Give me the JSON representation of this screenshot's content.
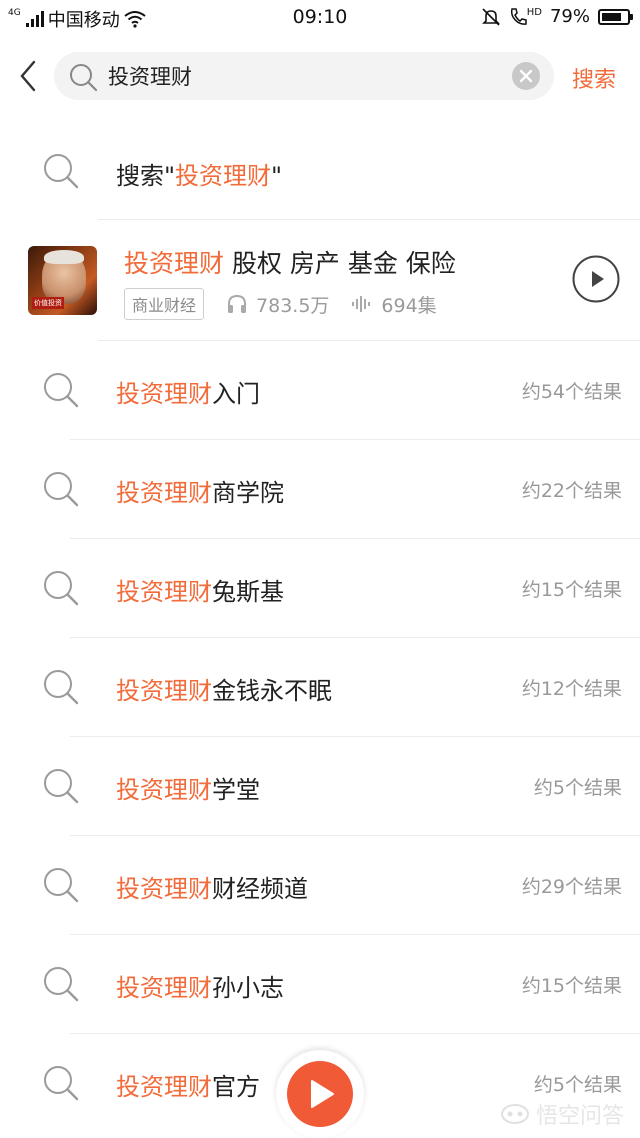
{
  "status_bar": {
    "network": "4G",
    "carrier": "中国移动",
    "time": "09:10",
    "hd": "HD",
    "battery": "79%",
    "battery_level": 0.79
  },
  "search": {
    "query": "投资理财",
    "button_label": "搜索"
  },
  "first_suggestion": {
    "prefix": "搜索\"",
    "keyword": "投资理财",
    "suffix": "\""
  },
  "album": {
    "cover_tag": "价值投资",
    "title_highlight": "投资理财",
    "title_rest": " 股权 房产 基金 保险",
    "category": "商业财经",
    "plays": "783.5万",
    "episodes": "694集"
  },
  "suggestions": [
    {
      "keyword": "投资理财",
      "rest": "入门",
      "count": "约54个结果"
    },
    {
      "keyword": "投资理财",
      "rest": "商学院",
      "count": "约22个结果"
    },
    {
      "keyword": "投资理财",
      "rest": "兔斯基",
      "count": "约15个结果"
    },
    {
      "keyword": "投资理财",
      "rest": "金钱永不眠",
      "count": "约12个结果"
    },
    {
      "keyword": "投资理财",
      "rest": "学堂",
      "count": "约5个结果"
    },
    {
      "keyword": "投资理财",
      "rest": "财经频道",
      "count": "约29个结果"
    },
    {
      "keyword": "投资理财",
      "rest": "孙小志",
      "count": "约15个结果"
    },
    {
      "keyword": "投资理财",
      "rest": "官方",
      "count": "约5个结果"
    }
  ],
  "watermark": "悟空问答",
  "colors": {
    "accent": "#f26b3a",
    "fab": "#f05a36",
    "muted": "#999999"
  }
}
